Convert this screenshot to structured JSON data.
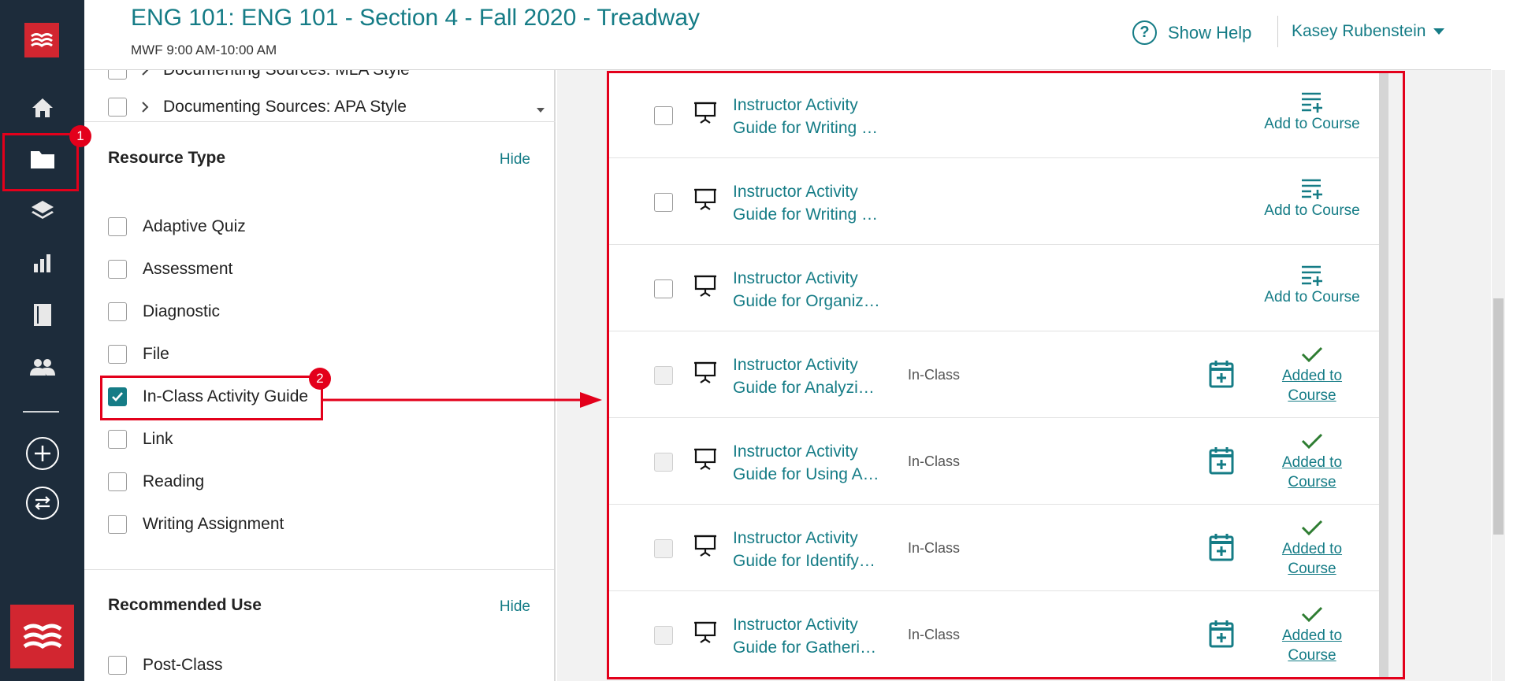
{
  "header": {
    "course_title": "ENG 101: ENG 101 - Section 4 - Fall 2020 - Treadway",
    "schedule": "MWF 9:00 AM-10:00 AM",
    "help_label": "Show Help",
    "user_name": "Kasey Rubenstein"
  },
  "nav": {
    "items": [
      "home-icon",
      "folder-icon",
      "layers-icon",
      "bar-chart-icon",
      "notebook-icon",
      "people-icon",
      "plus-circle-icon",
      "swap-icon"
    ],
    "active": "folder-icon"
  },
  "tree": {
    "items": [
      {
        "label": "Documenting Sources: MLA Style"
      },
      {
        "label": "Documenting Sources: APA Style"
      }
    ]
  },
  "filters": {
    "resource_type": {
      "title": "Resource Type",
      "hide_label": "Hide",
      "options": [
        {
          "label": "Adaptive Quiz",
          "checked": false
        },
        {
          "label": "Assessment",
          "checked": false
        },
        {
          "label": "Diagnostic",
          "checked": false
        },
        {
          "label": "File",
          "checked": false
        },
        {
          "label": "In-Class Activity Guide",
          "checked": true
        },
        {
          "label": "Link",
          "checked": false
        },
        {
          "label": "Reading",
          "checked": false
        },
        {
          "label": "Writing Assignment",
          "checked": false
        }
      ]
    },
    "recommended_use": {
      "title": "Recommended Use",
      "hide_label": "Hide",
      "options": [
        {
          "label": "Post-Class",
          "checked": false
        }
      ]
    }
  },
  "results": [
    {
      "line1": "Instructor Activity",
      "line2": "Guide for Writing …",
      "tag": "",
      "status": "Add to Course"
    },
    {
      "line1": "Instructor Activity",
      "line2": "Guide for Writing …",
      "tag": "",
      "status": "Add to Course"
    },
    {
      "line1": "Instructor Activity",
      "line2": "Guide for Organiz…",
      "tag": "",
      "status": "Add to Course"
    },
    {
      "line1": "Instructor Activity",
      "line2": "Guide for Analyzi…",
      "tag": "In-Class",
      "status_line1": "Added to",
      "status_line2": "Course"
    },
    {
      "line1": "Instructor Activity",
      "line2": "Guide for Using A…",
      "tag": "In-Class",
      "status_line1": "Added to",
      "status_line2": "Course"
    },
    {
      "line1": "Instructor Activity",
      "line2": "Guide for Identify…",
      "tag": "In-Class",
      "status_line1": "Added to",
      "status_line2": "Course"
    },
    {
      "line1": "Instructor Activity",
      "line2": "Guide for Gatheri…",
      "tag": "In-Class",
      "status_line1": "Added to",
      "status_line2": "Course"
    }
  ],
  "annotations": {
    "badge_1": "1",
    "badge_2": "2",
    "color": "#e3001b"
  },
  "colors": {
    "accent": "#157c86",
    "rail": "#1d2c3b",
    "brand": "#d22630",
    "check_green": "#2e7d32"
  }
}
